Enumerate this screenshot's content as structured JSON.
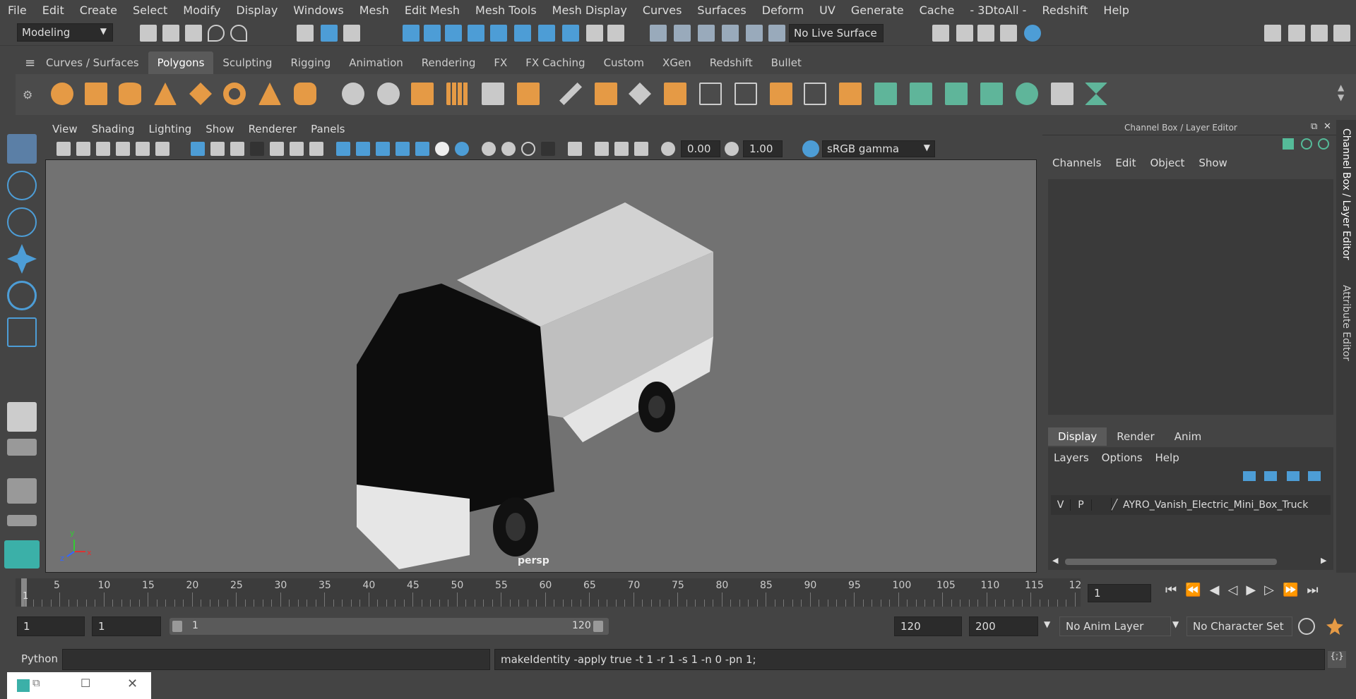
{
  "menubar": {
    "items": [
      "File",
      "Edit",
      "Create",
      "Select",
      "Modify",
      "Display",
      "Windows",
      "Mesh",
      "Edit Mesh",
      "Mesh Tools",
      "Mesh Display",
      "Curves",
      "Surfaces",
      "Deform",
      "UV",
      "Generate",
      "Cache",
      "- 3DtoAll -",
      "Redshift",
      "Help"
    ]
  },
  "statusline": {
    "mode": "Modeling",
    "live_surface": "No Live Surface"
  },
  "shelf": {
    "tabs": [
      "Curves / Surfaces",
      "Polygons",
      "Sculpting",
      "Rigging",
      "Animation",
      "Rendering",
      "FX",
      "FX Caching",
      "Custom",
      "XGen",
      "Redshift",
      "Bullet"
    ],
    "active": "Polygons"
  },
  "viewport": {
    "menu": [
      "View",
      "Shading",
      "Lighting",
      "Show",
      "Renderer",
      "Panels"
    ],
    "exposure": "0.00",
    "gamma": "1.00",
    "color_space": "sRGB gamma",
    "camera_label": "persp",
    "axis": {
      "x": "x",
      "y": "y",
      "z": "z"
    }
  },
  "channelbox": {
    "title": "Channel Box / Layer Editor",
    "menu": [
      "Channels",
      "Edit",
      "Object",
      "Show"
    ],
    "layer_tabs": [
      "Display",
      "Render",
      "Anim"
    ],
    "layer_menu": [
      "Layers",
      "Options",
      "Help"
    ],
    "layer": {
      "v": "V",
      "p": "P",
      "name": "AYRO_Vanish_Electric_Mini_Box_Truck"
    },
    "side_tabs": [
      "Channel Box / Layer Editor",
      "Attribute Editor"
    ]
  },
  "timeline": {
    "ticks": [
      "5",
      "10",
      "15",
      "20",
      "25",
      "30",
      "35",
      "40",
      "45",
      "50",
      "55",
      "60",
      "65",
      "70",
      "75",
      "80",
      "85",
      "90",
      "95",
      "100",
      "105",
      "110",
      "115",
      "12"
    ],
    "current_marker": "1",
    "current_frame": "1"
  },
  "range": {
    "start": "1",
    "playback_start": "1",
    "slider_start": "1",
    "slider_end": "120",
    "playback_end": "120",
    "end": "200",
    "anim_layer": "No Anim Layer",
    "character_set": "No Character Set"
  },
  "cmdline": {
    "language": "Python",
    "output": "makeIdentity -apply true -t 1 -r 1 -s 1 -n 0 -pn 1;"
  }
}
